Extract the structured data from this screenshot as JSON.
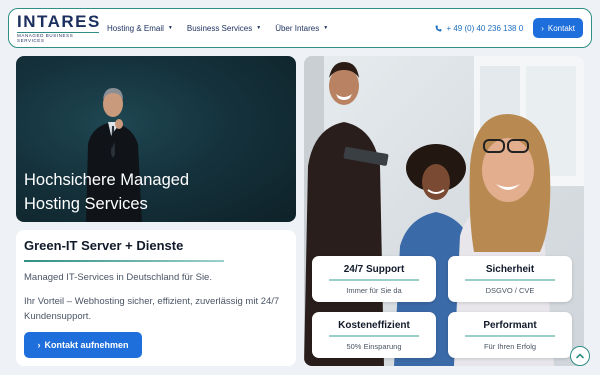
{
  "header": {
    "logo_main": "INTARES",
    "logo_sub": "MANAGED BUSINESS SERVICES",
    "nav": [
      {
        "label": "Hosting & Email"
      },
      {
        "label": "Business Services"
      },
      {
        "label": "Über Intares"
      }
    ],
    "caret": "▼",
    "phone": "+ 49 (0) 40 236 138 0",
    "kontakt": "Kontakt",
    "chevron": "›"
  },
  "hero": {
    "title": "Hochsichere Managed Hosting Services"
  },
  "card": {
    "title": "Green-IT Server + Dienste",
    "line1": "Managed IT-Services in Deutschland für Sie.",
    "line2": "Ihr Vorteil – Webhosting sicher, effizient, zuverlässig mit 24/7 Kundensupport.",
    "button": "Kontakt aufnehmen",
    "chevron": "›"
  },
  "tiles": [
    {
      "title": "24/7 Support",
      "sub": "Immer für Sie da"
    },
    {
      "title": "Sicherheit",
      "sub": "DSGVO / CVE"
    },
    {
      "title": "Kosteneffizient",
      "sub": "50% Einsparung"
    },
    {
      "title": "Performant",
      "sub": "Für Ihren Erfolg"
    }
  ],
  "colors": {
    "accent": "#1e6fdb",
    "brand": "#1b2f5e",
    "teal": "#2f8f86"
  },
  "icons": {
    "phone": "phone-icon",
    "scroll": "chevron-up-icon"
  }
}
